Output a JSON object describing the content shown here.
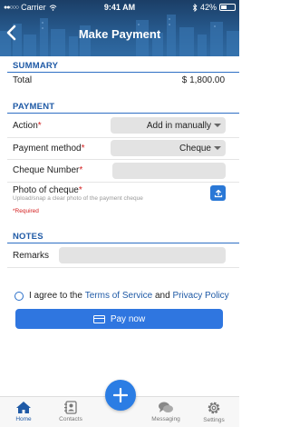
{
  "status_bar": {
    "carrier": "Carrier",
    "time": "9:41 AM",
    "battery": "42%",
    "battery_level": 0.42
  },
  "header": {
    "title": "Make Payment"
  },
  "summary": {
    "heading": "SUMMARY",
    "total_label": "Total",
    "total_value": "$ 1,800.00"
  },
  "payment": {
    "heading": "PAYMENT",
    "action_label": "Action",
    "action_value": "Add in manually",
    "method_label": "Payment method",
    "method_value": "Cheque",
    "cheque_number_label": "Cheque Number",
    "cheque_number_value": "",
    "photo_label": "Photo of cheque",
    "photo_hint": "Upload/snap a clear photo of the payment cheque",
    "required_note": "*Required",
    "required_mark": "*"
  },
  "notes": {
    "heading": "NOTES",
    "remarks_label": "Remarks",
    "remarks_value": ""
  },
  "agreement": {
    "prefix": "I agree to the",
    "terms_link": "Terms of Service",
    "conjunction": "and",
    "privacy_link": "Privacy Policy"
  },
  "pay_button": {
    "label": "Pay now"
  },
  "tabbar": {
    "items": [
      {
        "label": "Home",
        "icon": "home-icon",
        "active": true
      },
      {
        "label": "Contacts",
        "icon": "contacts-icon",
        "active": false
      },
      {
        "label": "",
        "icon": "plus-icon",
        "active": false
      },
      {
        "label": "Messaging",
        "icon": "chat-icon",
        "active": false
      },
      {
        "label": "Settings",
        "icon": "gear-icon",
        "active": false
      }
    ]
  },
  "colors": {
    "accent": "#1f5aa6",
    "button": "#2f76e0",
    "required": "#d42020",
    "header_top": "#1b3e66"
  }
}
